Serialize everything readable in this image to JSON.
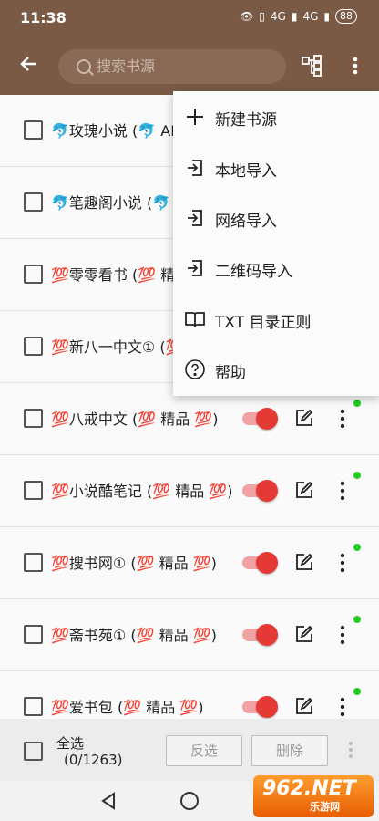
{
  "status_bar": {
    "time": "11:38",
    "network_1": "4G",
    "network_2": "4G",
    "battery": "88"
  },
  "toolbar": {
    "search_placeholder": "搜索书源"
  },
  "menu": {
    "items": [
      {
        "label": "新建书源",
        "icon": "plus-icon"
      },
      {
        "label": "本地导入",
        "icon": "import-icon"
      },
      {
        "label": "网络导入",
        "icon": "import-icon"
      },
      {
        "label": "二维码导入",
        "icon": "import-icon"
      },
      {
        "label": "TXT 目录正则",
        "icon": "book-icon"
      },
      {
        "label": "帮助",
        "icon": "help-icon"
      }
    ]
  },
  "sources": [
    {
      "name": "🐬玫瑰小说 (🐬 AP"
    },
    {
      "name": "🐬笔趣阁小说 (🐬"
    },
    {
      "name": "💯零零看书 (💯 精"
    },
    {
      "name": "💯新八一中文① (💯"
    },
    {
      "name": "💯八戒中文 (💯 精品 💯)"
    },
    {
      "name": "💯小说酷笔记 (💯 精品 💯)"
    },
    {
      "name": "💯搜书网① (💯 精品 💯)"
    },
    {
      "name": "💯斋书苑① (💯 精品 💯)"
    },
    {
      "name": "💯爱书包 (💯 精品 💯)"
    }
  ],
  "bottom_bar": {
    "select_all_label": "全选",
    "count": "(0/1263)",
    "invert_label": "反选",
    "delete_label": "删除"
  },
  "watermark": {
    "main": "962.NET",
    "sub": "乐游网"
  },
  "colors": {
    "toolbar": "#7b5a45",
    "switch_on": "#e53935",
    "status_dot": "#22cc22"
  }
}
